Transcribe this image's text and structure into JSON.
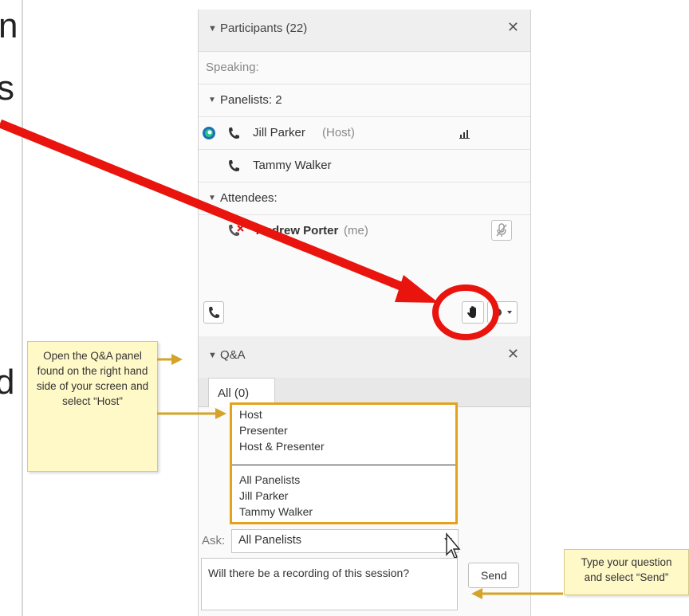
{
  "slide_fragment": {
    "letters": [
      "n",
      "s",
      "d"
    ]
  },
  "participants": {
    "title": "Participants (22)",
    "speaking_label": "Speaking:",
    "panelists_label": "Panelists: 2",
    "attendees_label": "Attendees:",
    "panelists": [
      {
        "name": "Jill Parker",
        "role": "(Host)"
      },
      {
        "name": "Tammy Walker",
        "role": ""
      }
    ],
    "attendees": [
      {
        "name": "Andrew Porter",
        "role": "(me)"
      }
    ]
  },
  "qa": {
    "title": "Q&A",
    "tab_label": "All (0)",
    "menu_items_top": [
      "Host",
      "Presenter",
      "Host & Presenter"
    ],
    "menu_items_bottom": [
      "All Panelists",
      "Jill Parker",
      "Tammy Walker"
    ],
    "ask_label": "Ask:",
    "ask_value": "All Panelists",
    "question_text": "Will there be a recording of this session?",
    "send_label": "Send"
  },
  "callouts": {
    "qa_instruction": "Open the Q&A panel found on the right hand side of your screen and select “Host”",
    "send_instruction": "Type your question and select “Send”"
  },
  "colors": {
    "arrow_red": "#e8140d",
    "callout_arrow": "#d4a327",
    "menu_border": "#e3a21a",
    "callout_bg": "#fff8c7"
  }
}
